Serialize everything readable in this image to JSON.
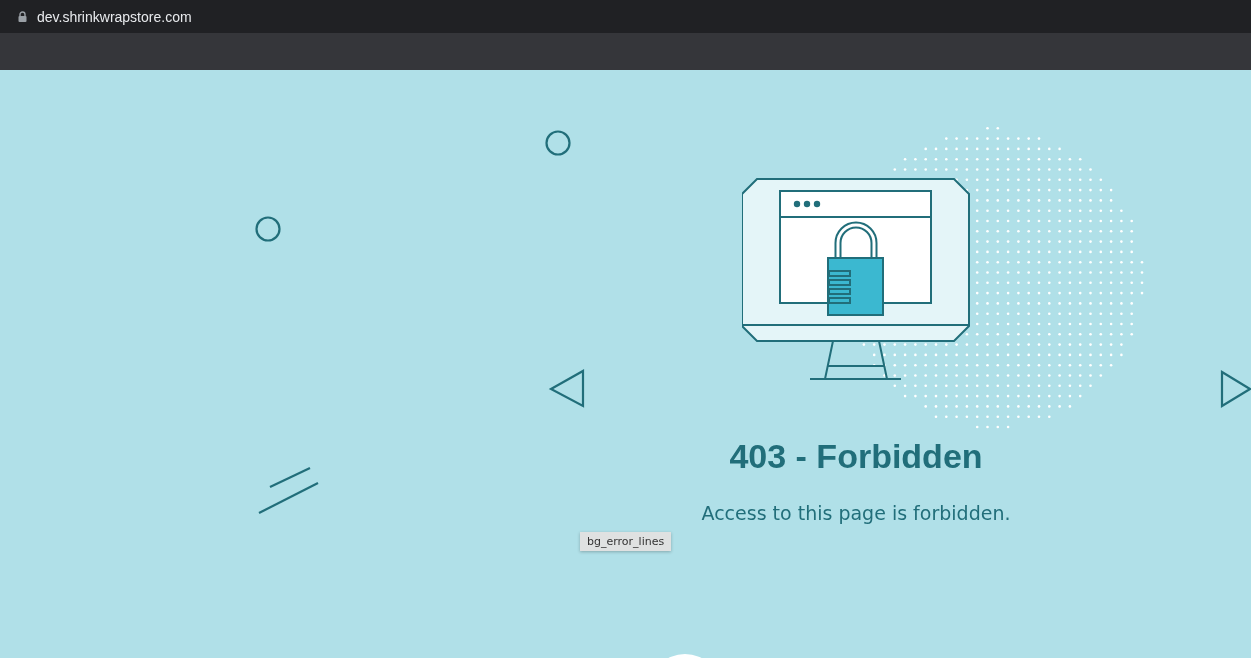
{
  "browser": {
    "url": "dev.shrinkwrapstore.com"
  },
  "page": {
    "title": "403 - Forbidden",
    "message": "Access to this page is forbidden.",
    "tooltip": "bg_error_lines"
  }
}
